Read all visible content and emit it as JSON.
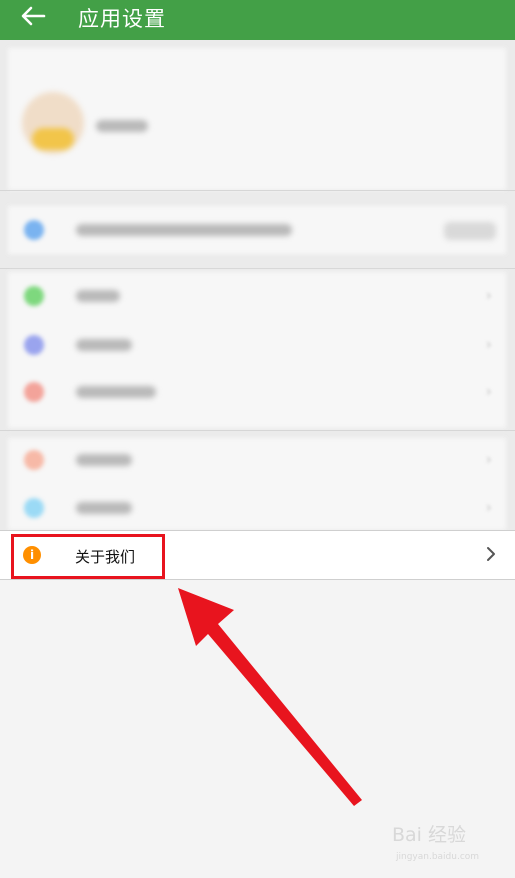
{
  "header": {
    "title": "应用设置"
  },
  "about_row": {
    "label": "关于我们",
    "icon": "info-icon",
    "icon_glyph": "i"
  },
  "colors": {
    "header_bg": "#43a047",
    "info_icon": "#ff8f00",
    "highlight": "#e8141e",
    "arrow": "#e8141e"
  },
  "watermark": {
    "text": "Bai 经验",
    "sub": "jingyan.baidu.com"
  }
}
